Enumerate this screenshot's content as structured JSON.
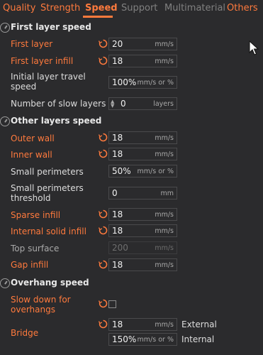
{
  "tabs": [
    {
      "label": "Quality"
    },
    {
      "label": "Strength"
    },
    {
      "label": "Speed"
    },
    {
      "label": "Support"
    },
    {
      "label": "Multimaterial"
    },
    {
      "label": "Others"
    }
  ],
  "sections": {
    "first_layer": "First layer speed",
    "other_layers": "Other layers speed",
    "overhang": "Overhang speed"
  },
  "fields": {
    "first_layer": {
      "label": "First layer",
      "value": "20",
      "unit": "mm/s"
    },
    "first_layer_infill": {
      "label": "First layer infill",
      "value": "18",
      "unit": "mm/s"
    },
    "initial_layer_travel": {
      "label": "Initial layer travel speed",
      "value": "100%",
      "unit": "mm/s or %"
    },
    "slow_layers": {
      "label": "Number of slow layers",
      "value": "0",
      "unit": "layers"
    },
    "outer_wall": {
      "label": "Outer wall",
      "value": "18",
      "unit": "mm/s"
    },
    "inner_wall": {
      "label": "Inner wall",
      "value": "18",
      "unit": "mm/s"
    },
    "small_perimeters": {
      "label": "Small perimeters",
      "value": "50%",
      "unit": "mm/s or %"
    },
    "small_perimeters_threshold": {
      "label": "Small perimeters threshold",
      "value": "0",
      "unit": "mm"
    },
    "sparse_infill": {
      "label": "Sparse infill",
      "value": "18",
      "unit": "mm/s"
    },
    "internal_solid_infill": {
      "label": "Internal solid infill",
      "value": "18",
      "unit": "mm/s"
    },
    "top_surface": {
      "label": "Top surface",
      "value": "200",
      "unit": "mm/s"
    },
    "gap_infill": {
      "label": "Gap infill",
      "value": "18",
      "unit": "mm/s"
    },
    "slow_down_overhangs": {
      "label": "Slow down for overhangs",
      "checked": false
    },
    "bridge": {
      "label": "Bridge",
      "external": {
        "value": "18",
        "unit": "mm/s",
        "label": "External"
      },
      "internal": {
        "value": "150%",
        "unit": "mm/s or %",
        "label": "Internal"
      }
    }
  },
  "colors": {
    "accent": "#ff7a3d",
    "background": "#2b2b2d",
    "disabled": "#6e6e6e"
  }
}
